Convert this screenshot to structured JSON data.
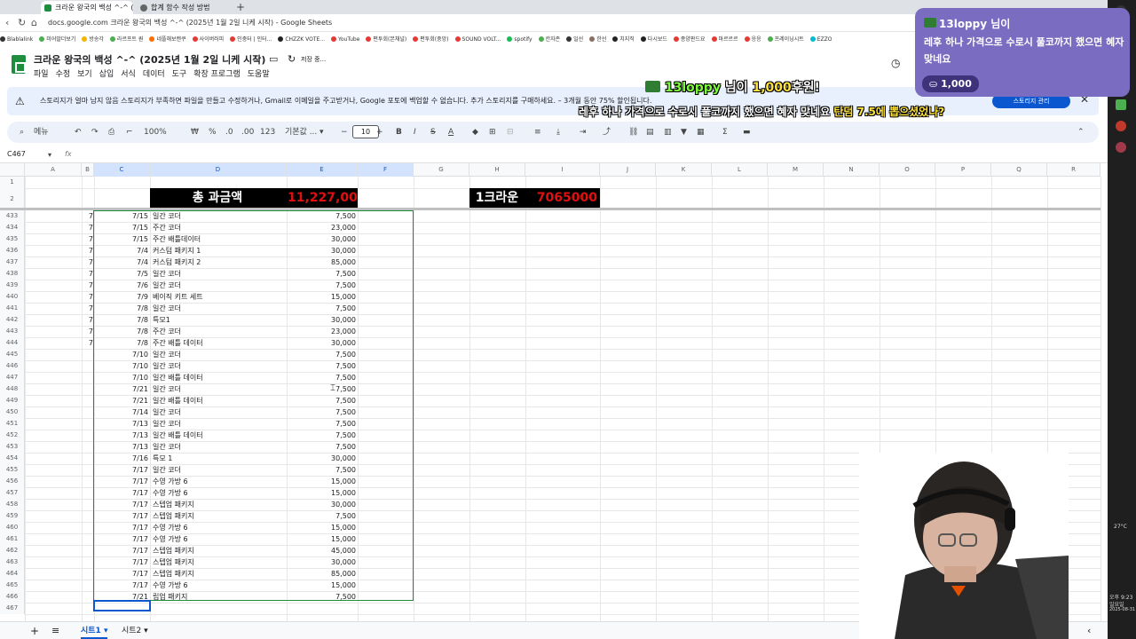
{
  "browser": {
    "tabs": [
      {
        "label": "크라운 왕국의 백성 ^-^ (2025년 1월 2일 니케 시작)"
      },
      {
        "label": "합계 함수 작성 방법"
      }
    ],
    "newtab": "+",
    "url": "docs.google.com 크라운 왕국의 백성 ^-^ (2025년 1월 2일 니케 시작) - Google Sheets"
  },
  "bookmarks": [
    {
      "label": "Blablalink",
      "color": "#333"
    },
    {
      "label": "미어말더보기",
      "color": "#4caf50"
    },
    {
      "label": "방송각",
      "color": "#f5b400"
    },
    {
      "label": "라르프트 퀀",
      "color": "#4caf50"
    },
    {
      "label": "네플해보캔쿠",
      "color": "#ff6d00"
    },
    {
      "label": "사이버러피",
      "color": "#e53935"
    },
    {
      "label": "인중터 | 인터...",
      "color": "#e53935"
    },
    {
      "label": "CHZZK VOTE...",
      "color": "#222"
    },
    {
      "label": "YouTube",
      "color": "#e53935"
    },
    {
      "label": "편투회(본채널)",
      "color": "#e53935"
    },
    {
      "label": "편투회(중앙)",
      "color": "#e53935"
    },
    {
      "label": "SOUND VOLT...",
      "color": "#e53935"
    },
    {
      "label": "spotify",
      "color": "#1db954"
    },
    {
      "label": "칸자존",
      "color": "#4caf50"
    },
    {
      "label": "일선",
      "color": "#333"
    },
    {
      "label": "한선",
      "color": "#8d6e63"
    },
    {
      "label": "치지직",
      "color": "#222"
    },
    {
      "label": "다시보드",
      "color": "#222"
    },
    {
      "label": "종양판드요",
      "color": "#e53935"
    },
    {
      "label": "마르르르",
      "color": "#e53935"
    },
    {
      "label": "응응",
      "color": "#e53935"
    },
    {
      "label": "프레이닝시트",
      "color": "#4caf50"
    },
    {
      "label": "EZZO",
      "color": "#00bcd4"
    }
  ],
  "app": {
    "title": "크라운 왕국의 백성 ^-^ (2025년 1월 2일 니케 시작)",
    "saved": "저장 중...",
    "menus": [
      "파일",
      "수정",
      "보기",
      "삽입",
      "서식",
      "데이터",
      "도구",
      "확장 프로그램",
      "도움말"
    ]
  },
  "banner": {
    "text": "스토리지가 얼마 남지 않음  스토리지가 부족하면 파일을 만들고 수정하거나, Gmail로 이메일을 주고받거나, Google 포토에 백업할 수 없습니다. 추가 스토리지를 구매하세요. – 3개월 동안 75% 할인됩니다.",
    "button": "스토리지 관리"
  },
  "toolbar": {
    "search": "메뉴",
    "zoom": "100%",
    "won": "₩",
    "pct": "%",
    "dec1": ".0",
    "dec2": ".00",
    "num": "123",
    "font": "기본값 ...",
    "fontsize": "10"
  },
  "formula": {
    "cellref": "C467",
    "fx": "fx",
    "value": ""
  },
  "columns": [
    "A",
    "B",
    "C",
    "D",
    "E",
    "F",
    "G",
    "H",
    "I",
    "J",
    "K",
    "L",
    "M",
    "N",
    "O",
    "P",
    "Q",
    "R"
  ],
  "header_row": {
    "total_label": "총 과금액",
    "total_value": "11,227,000",
    "crown_label": "1크라운",
    "crown_value": "7065000"
  },
  "rows": [
    {
      "n": "433",
      "b": "7",
      "c": "7/15",
      "d": "일간 코더",
      "e": "7,500"
    },
    {
      "n": "434",
      "b": "7",
      "c": "7/15",
      "d": "주간 코더",
      "e": "23,000"
    },
    {
      "n": "435",
      "b": "7",
      "c": "7/15",
      "d": "주간 배틀데이터",
      "e": "30,000"
    },
    {
      "n": "436",
      "b": "7",
      "c": "7/4",
      "d": "커스텀 패키지 1",
      "e": "30,000"
    },
    {
      "n": "437",
      "b": "7",
      "c": "7/4",
      "d": "커스텀 패키지 2",
      "e": "85,000"
    },
    {
      "n": "438",
      "b": "7",
      "c": "7/5",
      "d": "일간 코더",
      "e": "7,500"
    },
    {
      "n": "439",
      "b": "7",
      "c": "7/6",
      "d": "일간 코더",
      "e": "7,500"
    },
    {
      "n": "440",
      "b": "7",
      "c": "7/9",
      "d": "베이직 키트 세트",
      "e": "15,000"
    },
    {
      "n": "441",
      "b": "7",
      "c": "7/8",
      "d": "일간 코더",
      "e": "7,500"
    },
    {
      "n": "442",
      "b": "7",
      "c": "7/8",
      "d": "특모1",
      "e": "30,000"
    },
    {
      "n": "443",
      "b": "7",
      "c": "7/8",
      "d": "주간 코더",
      "e": "23,000"
    },
    {
      "n": "444",
      "b": "7",
      "c": "7/8",
      "d": "주간 배틀 데이터",
      "e": "30,000"
    },
    {
      "n": "445",
      "b": "",
      "c": "7/10",
      "d": "일간 코더",
      "e": "7,500"
    },
    {
      "n": "446",
      "b": "",
      "c": "7/10",
      "d": "일간 코더",
      "e": "7,500"
    },
    {
      "n": "447",
      "b": "",
      "c": "7/10",
      "d": "일간 배틀 데이터",
      "e": "7,500"
    },
    {
      "n": "448",
      "b": "",
      "c": "7/21",
      "d": "일간 코더",
      "e": "7,500"
    },
    {
      "n": "449",
      "b": "",
      "c": "7/21",
      "d": "일간 배틀 데이터",
      "e": "7,500"
    },
    {
      "n": "450",
      "b": "",
      "c": "7/14",
      "d": "일간 코더",
      "e": "7,500"
    },
    {
      "n": "451",
      "b": "",
      "c": "7/13",
      "d": "일간 코더",
      "e": "7,500"
    },
    {
      "n": "452",
      "b": "",
      "c": "7/13",
      "d": "일간 배틀 데이터",
      "e": "7,500"
    },
    {
      "n": "453",
      "b": "",
      "c": "7/13",
      "d": "일간 코더",
      "e": "7,500"
    },
    {
      "n": "454",
      "b": "",
      "c": "7/16",
      "d": "특모 1",
      "e": "30,000"
    },
    {
      "n": "455",
      "b": "",
      "c": "7/17",
      "d": "일간 코더",
      "e": "7,500"
    },
    {
      "n": "456",
      "b": "",
      "c": "7/17",
      "d": "수영 가방 6",
      "e": "15,000"
    },
    {
      "n": "457",
      "b": "",
      "c": "7/17",
      "d": "수영 가방 6",
      "e": "15,000"
    },
    {
      "n": "458",
      "b": "",
      "c": "7/17",
      "d": "스텝업 패키지",
      "e": "30,000"
    },
    {
      "n": "459",
      "b": "",
      "c": "7/17",
      "d": "스텝업 패키지",
      "e": "7,500"
    },
    {
      "n": "460",
      "b": "",
      "c": "7/17",
      "d": "수영 가방 6",
      "e": "15,000"
    },
    {
      "n": "461",
      "b": "",
      "c": "7/17",
      "d": "수영 가방 6",
      "e": "15,000"
    },
    {
      "n": "462",
      "b": "",
      "c": "7/17",
      "d": "스텝업 패키지",
      "e": "45,000"
    },
    {
      "n": "463",
      "b": "",
      "c": "7/17",
      "d": "스텝업 패키지",
      "e": "30,000"
    },
    {
      "n": "464",
      "b": "",
      "c": "7/17",
      "d": "스텝업 패키지",
      "e": "85,000"
    },
    {
      "n": "465",
      "b": "",
      "c": "7/17",
      "d": "수영 가방 6",
      "e": "15,000"
    },
    {
      "n": "466",
      "b": "",
      "c": "7/21",
      "d": "립업 패키지",
      "e": "7,500"
    },
    {
      "n": "467",
      "b": "",
      "c": "",
      "d": "",
      "e": ""
    }
  ],
  "sheets": {
    "add": "+",
    "list": "≡",
    "tabs": [
      "시트1",
      "시트2"
    ]
  },
  "donation": {
    "user": "13loppy 님이",
    "message": "레후 하나 가격으로 수로시 풀코까지 했으면 혜자 맞네요",
    "amount": "1,000"
  },
  "overlay": {
    "user": "13loppy",
    "suffix": " 님이 ",
    "amount": "1,000",
    "after": "후원!",
    "message": "레후 하나 가격으로 수로시 풀코까지 했으면 혜자 맞네요 ",
    "highlight": "탄덤 7.5에 뽑으셨었나?"
  },
  "taskbar": {
    "temp": "27°C",
    "time": "오후 9:23",
    "day": "일요일",
    "date": "2025-08-31"
  }
}
